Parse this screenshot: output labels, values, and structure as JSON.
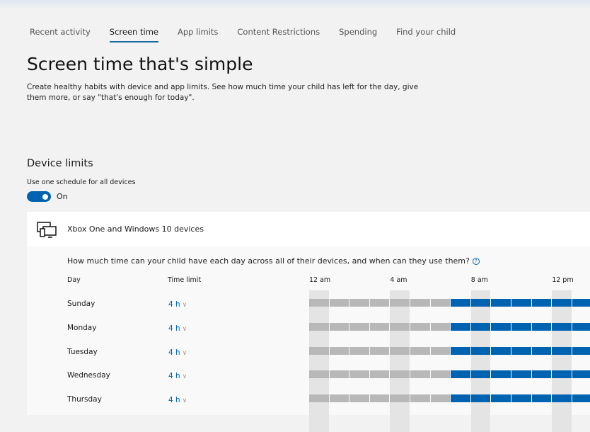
{
  "tabs": [
    {
      "label": "Recent activity"
    },
    {
      "label": "Screen time",
      "active": true
    },
    {
      "label": "App limits"
    },
    {
      "label": "Content Restrictions"
    },
    {
      "label": "Spending"
    },
    {
      "label": "Find your child"
    }
  ],
  "title": "Screen time that's simple",
  "description": "Create healthy habits with device and app limits. See how much time your child has left for the day, give them more, or say \"that's enough for today\".",
  "device_limits": {
    "heading": "Device limits",
    "schedule_label": "Use one schedule for all devices",
    "toggle_state": "On",
    "toggle_on": true
  },
  "device_card": {
    "icon": "devices-icon",
    "title": "Xbox One and Windows 10 devices",
    "question": "How much time can your child have each day across all of their devices, and when can they use them?",
    "help_icon": "?",
    "col_day": "Day",
    "col_limit": "Time limit",
    "hour_labels": [
      "12 am",
      "4 am",
      "8 am",
      "12 pm"
    ],
    "days": [
      {
        "day": "Sunday",
        "limit": "4 h",
        "allowed_from_hour": 7
      },
      {
        "day": "Monday",
        "limit": "4 h",
        "allowed_from_hour": 7
      },
      {
        "day": "Tuesday",
        "limit": "4 h",
        "allowed_from_hour": 7
      },
      {
        "day": "Wednesday",
        "limit": "4 h",
        "allowed_from_hour": 7
      },
      {
        "day": "Thursday",
        "limit": "4 h",
        "allowed_from_hour": 7
      }
    ]
  },
  "colors": {
    "accent": "#0063b1",
    "blocked": "#b8b8b8",
    "band": "#e4e4e4"
  }
}
